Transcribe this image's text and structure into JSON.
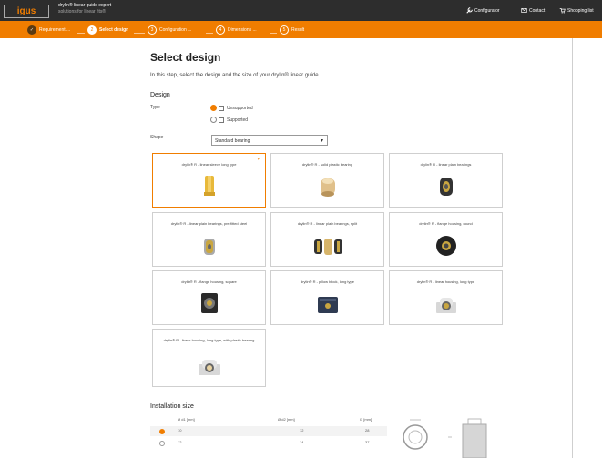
{
  "header": {
    "logo": "igus",
    "app_title": "drylin® linear guide expert",
    "app_subtitle": "solutions for linear fits®",
    "nav": [
      {
        "label": "Configurator",
        "icon": "wrench-icon"
      },
      {
        "label": "Contact",
        "icon": "mail-icon"
      },
      {
        "label": "Shopping list",
        "icon": "cart-icon"
      }
    ]
  },
  "steps": [
    {
      "num": "✓",
      "label": "Requirement ..."
    },
    {
      "num": "2",
      "label": "Select design"
    },
    {
      "num": "3",
      "label": "Configuration ..."
    },
    {
      "num": "4",
      "label": "Dimensions ..."
    },
    {
      "num": "5",
      "label": "Result"
    }
  ],
  "page": {
    "title": "Select design",
    "intro": "In this step, select the design and the size of your drylin® linear guide."
  },
  "design": {
    "heading": "Design",
    "type_label": "Type",
    "type_options": [
      {
        "label": "Unsupported",
        "selected": true
      },
      {
        "label": "Supported",
        "selected": false
      }
    ],
    "shape_label": "Shape",
    "shape_value": "Standard bearing"
  },
  "cards": [
    {
      "title": "drylin® R - linear sleeve long type",
      "selected": true,
      "product": "long-sleeve"
    },
    {
      "title": "drylin® R - solid plastic bearing",
      "selected": false,
      "product": "plastic-bearing"
    },
    {
      "title": "drylin® R - linear plain bearings",
      "selected": false,
      "product": "plain-bearing"
    },
    {
      "title": "drylin® R - linear plain bearings, pre-fitted steel",
      "selected": false,
      "product": "prefitted-bearing"
    },
    {
      "title": "drylin® R - linear plain bearings, split",
      "selected": false,
      "product": "split-bearing"
    },
    {
      "title": "drylin® R - flange housing, round",
      "selected": false,
      "product": "flange-round"
    },
    {
      "title": "drylin® R - flange housing, square",
      "selected": false,
      "product": "flange-square"
    },
    {
      "title": "drylin® R - pillow block, long type",
      "selected": false,
      "product": "pillow-block"
    },
    {
      "title": "drylin® R - linear housing, long type",
      "selected": false,
      "product": "linear-housing"
    },
    {
      "title": "drylin® R - linear housing, long type, with plastic bearing",
      "selected": false,
      "product": "linear-housing-plastic"
    }
  ],
  "installation": {
    "heading": "Installation size",
    "columns": [
      "Ø d1 [mm]",
      "Ø d2 [mm]",
      "l1 [mm]"
    ],
    "rows": [
      {
        "d1": "10",
        "d2": "12",
        "l1": "28",
        "selected": true
      },
      {
        "d1": "12",
        "d2": "14",
        "l1": "37",
        "selected": false
      }
    ]
  },
  "colors": {
    "accent": "#f07d00",
    "header_bg": "#2d2d2d"
  }
}
